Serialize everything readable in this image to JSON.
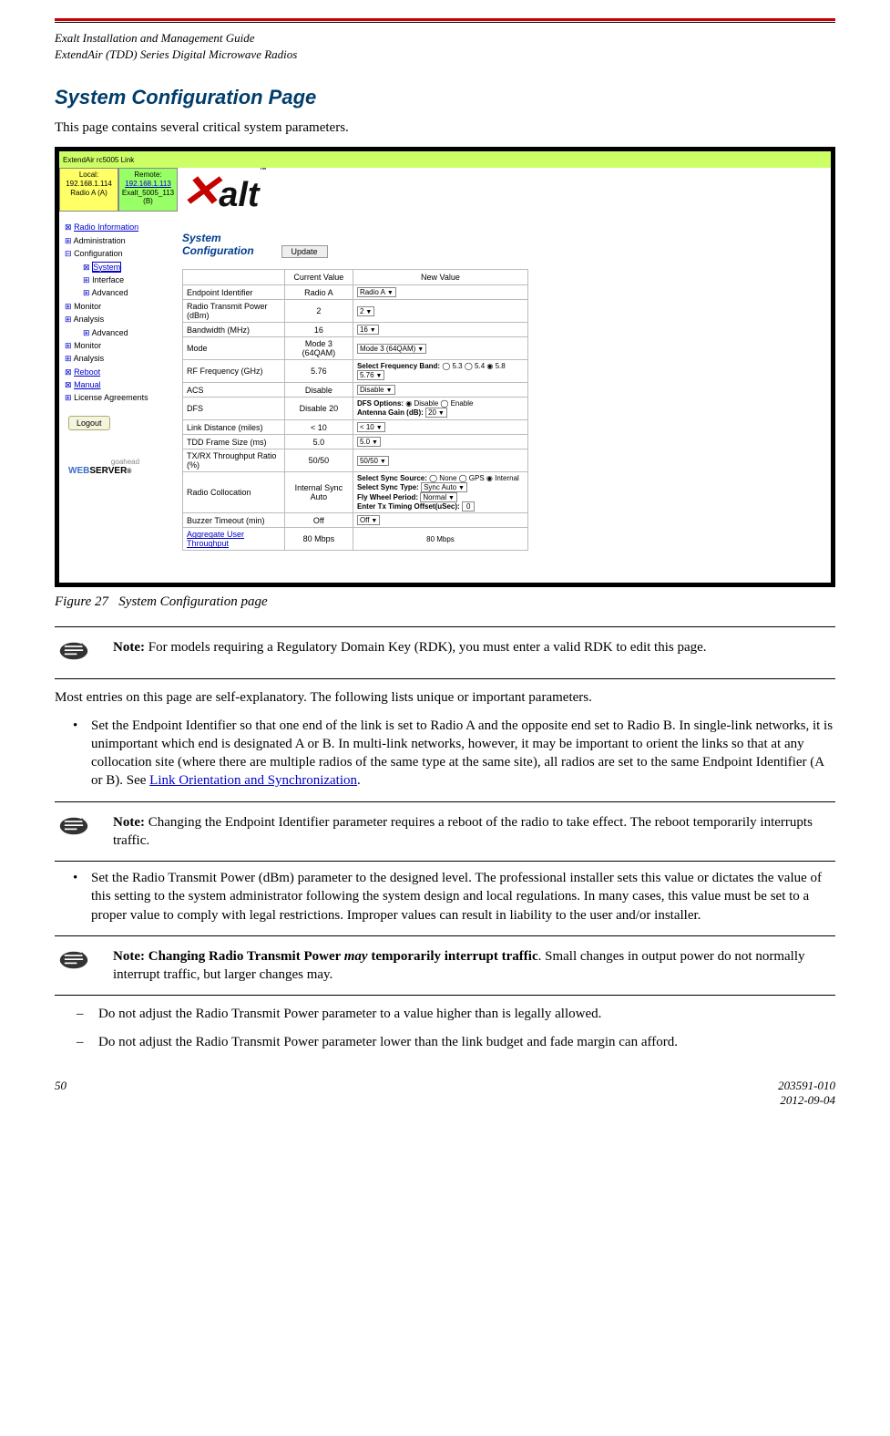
{
  "header": {
    "line1": "Exalt Installation and Management Guide",
    "line2": "ExtendAir (TDD) Series Digital Microwave Radios"
  },
  "heading": "System Configuration Page",
  "intro": "This page contains several critical system parameters.",
  "screenshot": {
    "topbar_model": "ExtendAir rc5005 Link",
    "tabs": {
      "local": {
        "title": "Local:",
        "ip": "192.168.1.114",
        "name": "Radio A (A)"
      },
      "remote": {
        "title": "Remote:",
        "ip": "192.168.1.113",
        "name": "Exalt_5005_113 (B)"
      }
    },
    "nav": {
      "radio_info": "Radio Information",
      "administration": "Administration",
      "configuration": "Configuration",
      "system": "System",
      "interface": "Interface",
      "advanced": "Advanced",
      "monitor": "Monitor",
      "analysis": "Analysis",
      "advanced2": "Advanced",
      "monitor2": "Monitor",
      "analysis2": "Analysis",
      "reboot": "Reboot",
      "manual": "Manual",
      "license": "License Agreements",
      "logout": "Logout"
    },
    "webserver": {
      "go": "goahead",
      "web": "WEB",
      "server": "SERVER"
    },
    "panel_title": "System Configuration",
    "update_btn": "Update",
    "table": {
      "hdr_current": "Current Value",
      "hdr_new": "New Value",
      "rows": {
        "endpoint": {
          "label": "Endpoint Identifier",
          "current": "Radio A",
          "new": "Radio A"
        },
        "txpower": {
          "label": "Radio Transmit Power (dBm)",
          "current": "2",
          "new": "2"
        },
        "bandwidth": {
          "label": "Bandwidth (MHz)",
          "current": "16",
          "new": "16"
        },
        "mode": {
          "label": "Mode",
          "current": "Mode 3 (64QAM)",
          "new": "Mode 3 (64QAM)"
        },
        "rffreq": {
          "label": "RF Frequency (GHz)",
          "current": "5.76",
          "new_label": "Select Frequency Band:",
          "opts": "◯ 5.3  ◯ 5.4  ◉ 5.8",
          "val": "5.76"
        },
        "acs": {
          "label": "ACS",
          "current": "Disable",
          "new": "Disable"
        },
        "dfs": {
          "label": "DFS",
          "current": "Disable 20",
          "new_label1": "DFS Options:",
          "opts": "◉ Disable  ◯ Enable",
          "new_label2": "Antenna Gain (dB):",
          "val": "20"
        },
        "linkdist": {
          "label": "Link Distance (miles)",
          "current": "< 10",
          "new": "< 10"
        },
        "tddframe": {
          "label": "TDD Frame Size (ms)",
          "current": "5.0",
          "new": "5.0"
        },
        "txrx": {
          "label": "TX/RX Throughput Ratio (%)",
          "current": "50/50",
          "new": "50/50"
        },
        "colloc": {
          "label": "Radio Collocation",
          "current": "Internal Sync Auto",
          "l1": "Select Sync Source:",
          "o1": "◯ None  ◯ GPS  ◉ Internal",
          "l2": "Select Sync Type:",
          "v2": "Sync Auto",
          "l3": "Fly Wheel Period:",
          "v3": "Normal",
          "l4": "Enter Tx Timing Offset(uSec):",
          "v4": "0"
        },
        "buzzer": {
          "label": "Buzzer Timeout (min)",
          "current": "Off",
          "new": "Off"
        },
        "aggregate": {
          "label": "Aggregate User Throughput",
          "current": "80 Mbps",
          "new": "80 Mbps"
        }
      }
    }
  },
  "figure": {
    "num": "Figure 27",
    "caption": "System Configuration page"
  },
  "note1": {
    "prefix": "Note:",
    "text": " For models requiring a Regulatory Domain Key (RDK), you must enter a valid RDK to edit this page."
  },
  "para1": "Most entries on this page are self-explanatory. The following lists unique or important parameters.",
  "bullet1": {
    "text_a": "Set the Endpoint Identifier so that one end of the link is set to Radio A and the opposite end set to Radio B. In single-link networks, it is unimportant which end is designated A or B. In multi-link networks, however, it may be important to orient the links so that at any collocation site (where there are multiple radios of the same type at the same site), all radios are set to the same Endpoint Identifier (A or B). See ",
    "link": "Link Orientation and Synchronization",
    "text_b": "."
  },
  "note2": {
    "prefix": "Note:",
    "text": " Changing the Endpoint Identifier parameter requires a reboot of the radio to take effect. The reboot temporarily interrupts traffic."
  },
  "bullet2": "Set the Radio Transmit Power (dBm) parameter to the designed level. The professional installer sets this value or dictates the value of this setting to the system administrator following the system design and local regulations. In many cases, this value must be set to a proper value to comply with legal restrictions. Improper values can result in liability to the user and/or installer.",
  "note3": {
    "prefix_bold": "Note: Changing Radio Transmit Power ",
    "may": "may",
    "prefix_bold2": " temporarily interrupt traffic",
    "text": ". Small changes in output power do not normally interrupt traffic, but larger changes may."
  },
  "sub1": "Do not adjust the Radio Transmit Power parameter to a value higher than is legally allowed.",
  "sub2": "Do not adjust the Radio Transmit Power parameter lower than the link budget and fade margin can afford.",
  "footer": {
    "page": "50",
    "docnum": "203591-010",
    "date": "2012-09-04"
  }
}
